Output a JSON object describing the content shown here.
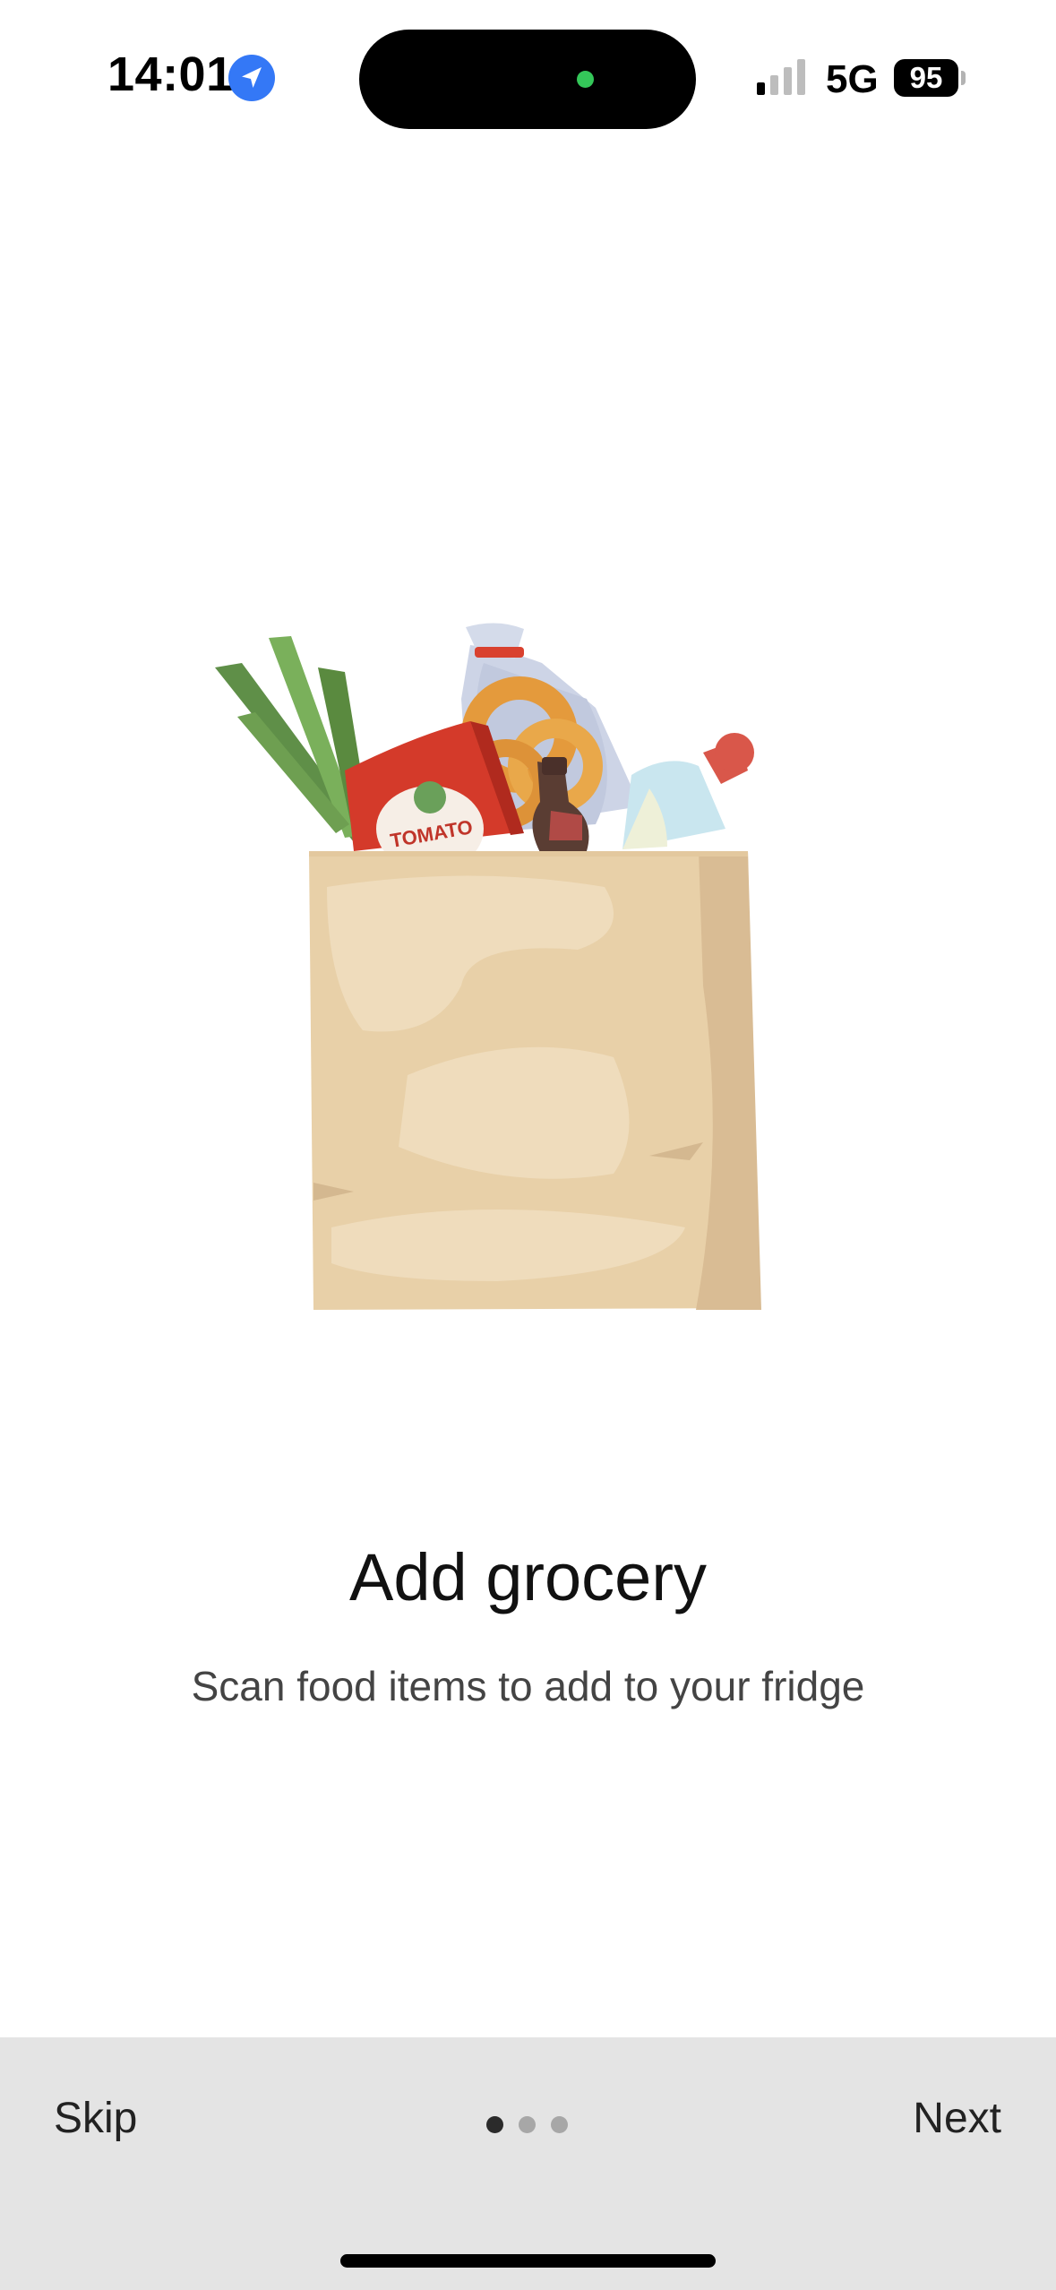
{
  "status_bar": {
    "time": "14:01",
    "network": "5G",
    "battery": "95",
    "icons": [
      "location-arrow-icon",
      "signal-bars-icon",
      "battery-icon"
    ]
  },
  "illustration": {
    "icon": "grocery-bag-illustration",
    "label": "TOMATO"
  },
  "onboarding": {
    "title": "Add grocery",
    "subtitle": "Scan food items to add to your fridge",
    "page_index": 1,
    "page_count": 3
  },
  "bottom_bar": {
    "skip_label": "Skip",
    "next_label": "Next"
  },
  "colors": {
    "background": "#ffffff",
    "bottom_bar": "#e4e4e4",
    "location_blue": "#3478f6",
    "dot_active": "#2b2b2b",
    "dot_inactive": "#a7a7a7",
    "bag": "#e8d0a8"
  }
}
